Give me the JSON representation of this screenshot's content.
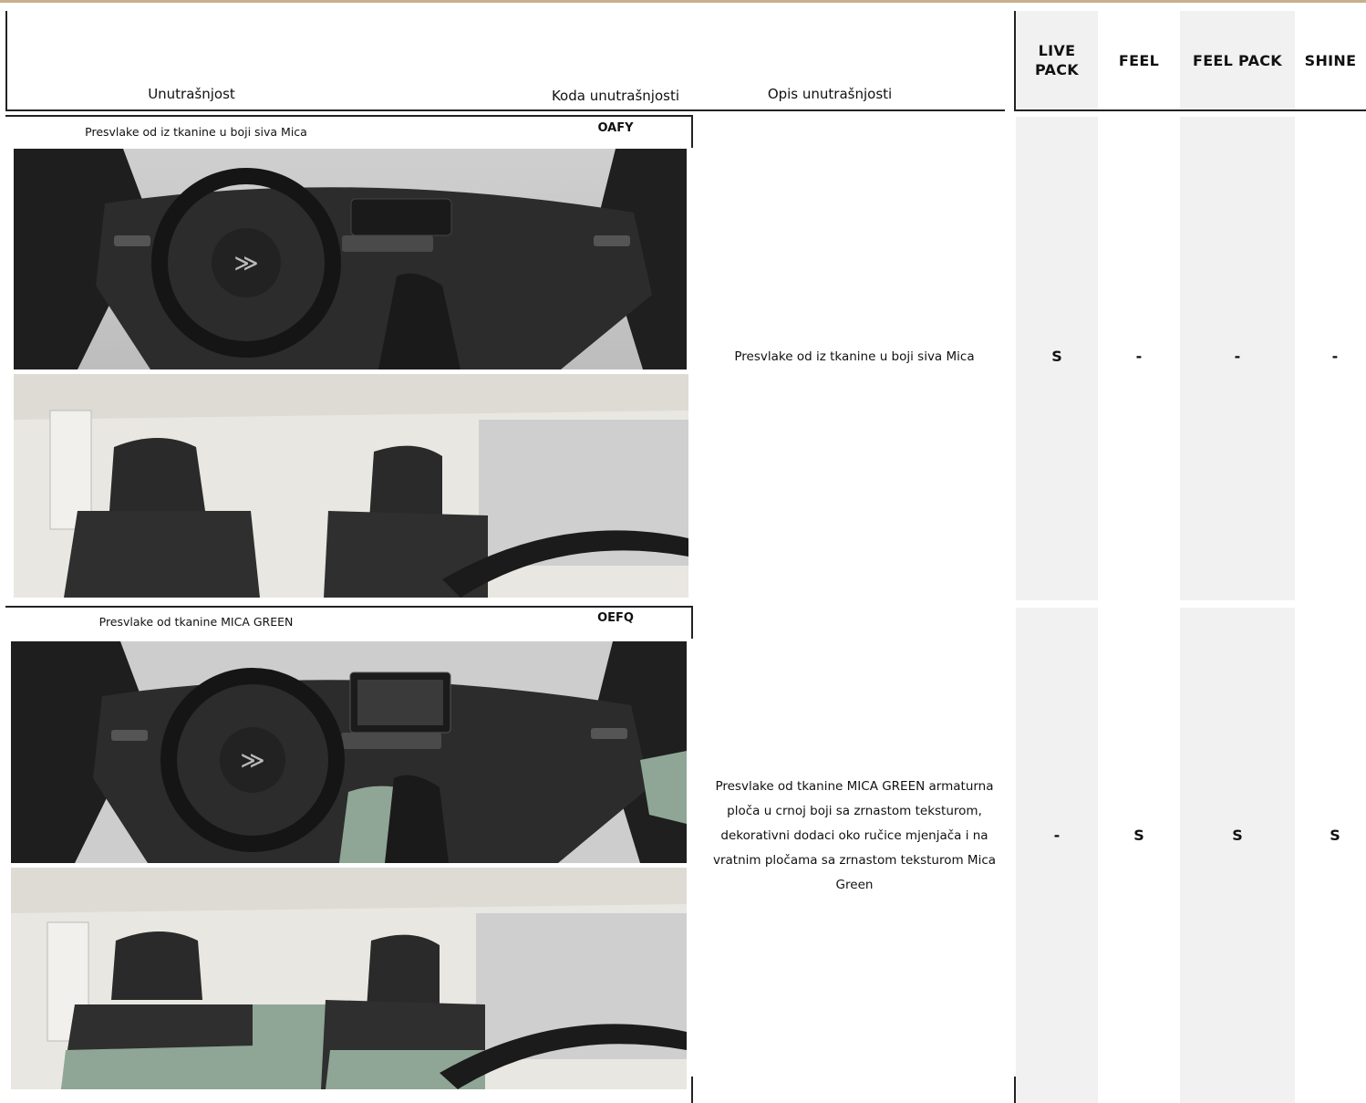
{
  "header": {
    "col_interior": "Unutrašnjost",
    "col_code": "Koda unutrašnjosti",
    "col_description": "Opis unutrašnjosti",
    "trims": [
      "LIVE PACK",
      "FEEL",
      "FEEL PACK",
      "SHINE"
    ]
  },
  "rows": [
    {
      "title": "Presvlake od iz tkanine u boji siva Mica",
      "code": "OAFY",
      "description": "Presvlake od iz tkanine u boji siva Mica",
      "values": [
        "S",
        "-",
        "-",
        "-"
      ],
      "accent": "#2a2a2a"
    },
    {
      "title": "Presvlake od tkanine MICA GREEN",
      "code": "OEFQ",
      "description": "Presvlake od tkanine MICA GREEN armaturna ploča u crnoj boji sa zrnastom teksturom, dekorativni dodaci oko ručice mjenjača i na vratnim pločama sa zrnastom teksturom Mica Green",
      "values": [
        "-",
        "S",
        "S",
        "S"
      ],
      "accent": "#8fa696"
    }
  ],
  "colors": {
    "top_rule": "#c7b08a",
    "trim_column_bg": "#f1f1f1"
  }
}
